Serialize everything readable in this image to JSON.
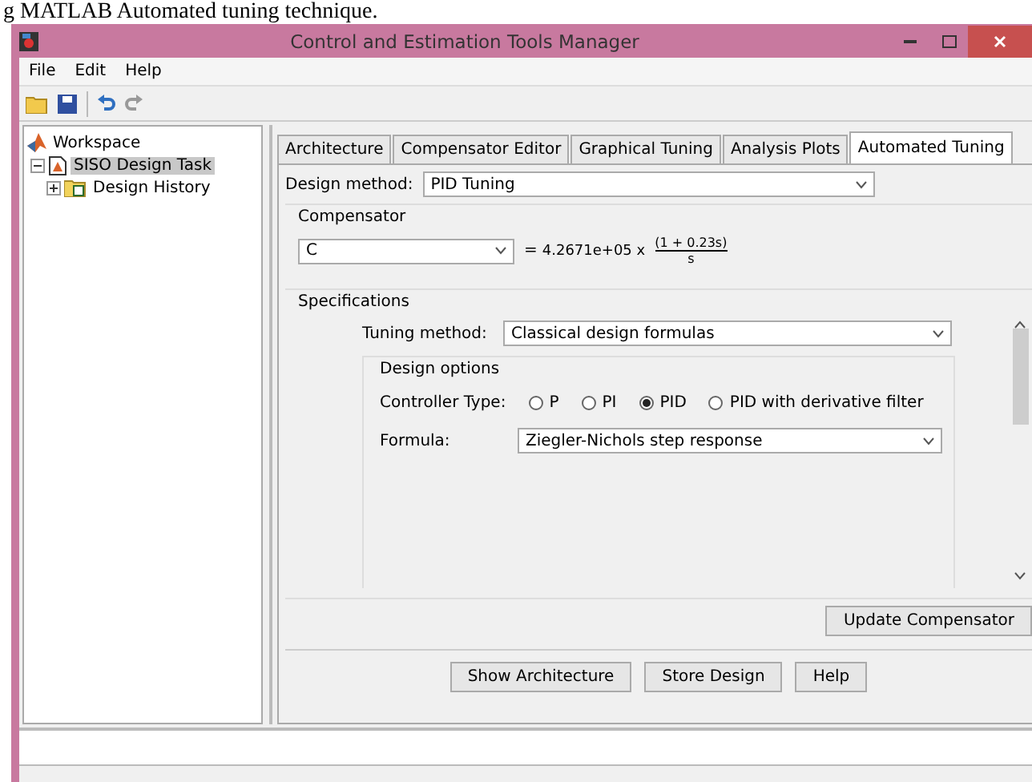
{
  "caption": "g MATLAB Automated tuning technique.",
  "window": {
    "title": "Control and Estimation Tools Manager"
  },
  "menu": [
    "File",
    "Edit",
    "Help"
  ],
  "tree": [
    {
      "label": "Workspace",
      "kind": "workspace",
      "selected": false,
      "children": [
        {
          "label": "SISO Design Task",
          "kind": "task",
          "selected": true,
          "expanded": true,
          "children": [
            {
              "label": "Design History",
              "kind": "history",
              "selected": false,
              "expanded": false
            }
          ]
        }
      ]
    }
  ],
  "tabs": [
    {
      "label": "Architecture",
      "selected": false
    },
    {
      "label": "Compensator Editor",
      "selected": false
    },
    {
      "label": "Graphical Tuning",
      "selected": false
    },
    {
      "label": "Analysis Plots",
      "selected": false
    },
    {
      "label": "Automated Tuning",
      "selected": true
    }
  ],
  "design_method": {
    "label": "Design method:",
    "value": "PID Tuning"
  },
  "compensator": {
    "title": "Compensator",
    "name": "C",
    "equals": "=",
    "gain": "4.2671e+05 x",
    "numerator": "(1 + 0.23s)",
    "denominator": "s"
  },
  "specifications": {
    "title": "Specifications",
    "tuning_label": "Tuning method:",
    "tuning_value": "Classical design formulas",
    "design_options": {
      "title": "Design options",
      "controller_label": "Controller Type:",
      "controller_types": [
        {
          "label": "P",
          "selected": false
        },
        {
          "label": "PI",
          "selected": false
        },
        {
          "label": "PID",
          "selected": true
        },
        {
          "label": "PID with derivative filter",
          "selected": false
        }
      ],
      "formula_label": "Formula:",
      "formula_value": "Ziegler-Nichols step response"
    }
  },
  "update_button": "Update Compensator",
  "buttons": [
    "Show Architecture",
    "Store Design",
    "Help"
  ]
}
